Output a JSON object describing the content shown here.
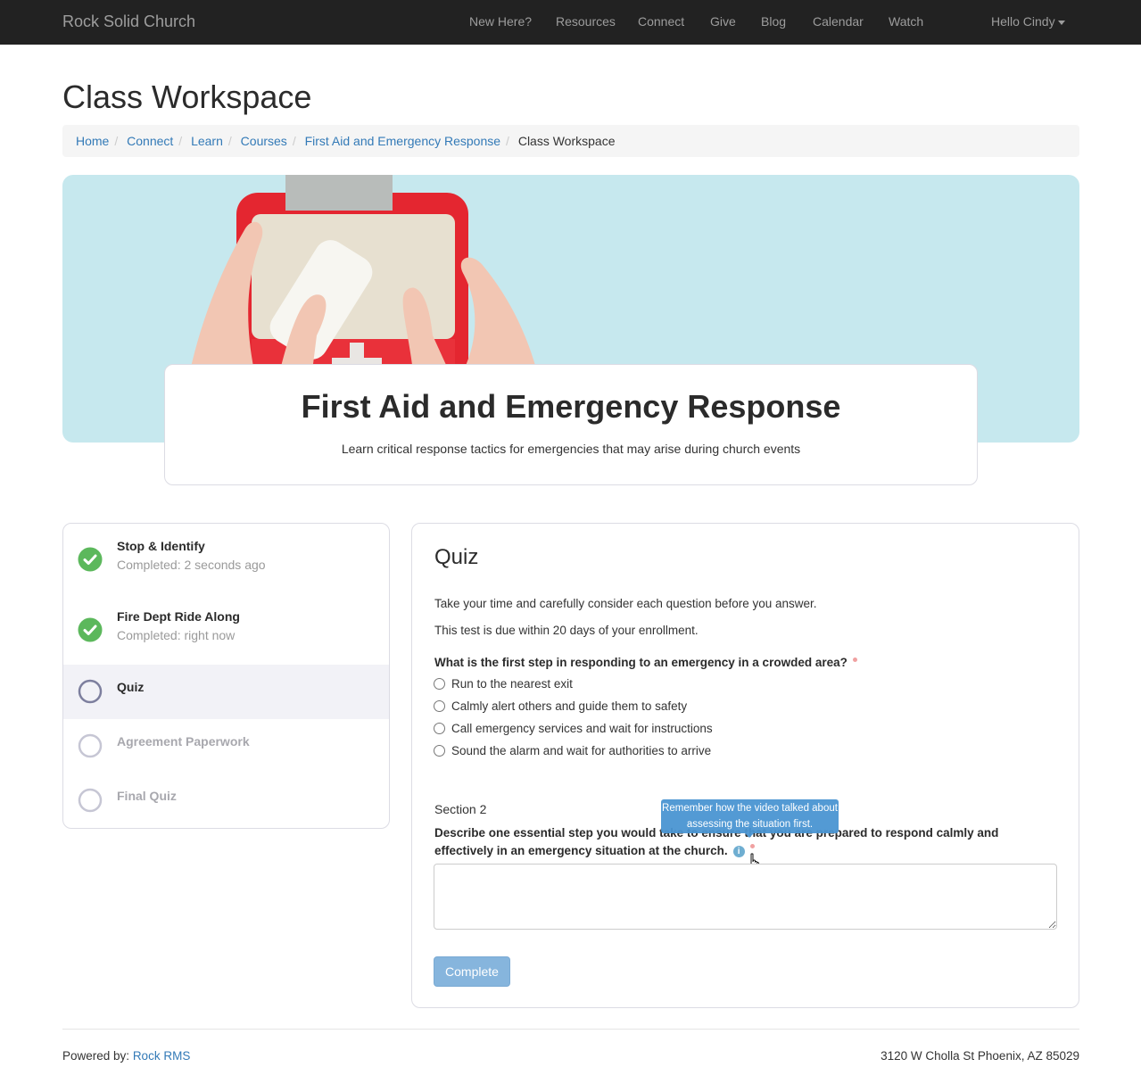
{
  "navbar": {
    "brand": "Rock Solid Church",
    "links": [
      "New Here?",
      "Resources",
      "Connect",
      "Give",
      "Blog",
      "Calendar",
      "Watch"
    ],
    "user_menu": "Hello Cindy"
  },
  "page": {
    "title": "Class Workspace",
    "breadcrumb": [
      "Home",
      "Connect",
      "Learn",
      "Courses",
      "First Aid and Emergency Response"
    ],
    "breadcrumb_current": "Class Workspace"
  },
  "hero": {
    "title": "First Aid and Emergency Response",
    "subtitle": "Learn critical response tactics for emergencies that may arise during church events",
    "background_color": "#c6e8ee"
  },
  "activities": [
    {
      "title": "Stop & Identify",
      "status": "completed",
      "subtitle": "Completed: 2 seconds ago"
    },
    {
      "title": "Fire Dept Ride Along",
      "status": "completed",
      "subtitle": "Completed: right now"
    },
    {
      "title": "Quiz",
      "status": "current",
      "subtitle": ""
    },
    {
      "title": "Agreement Paperwork",
      "status": "locked",
      "subtitle": ""
    },
    {
      "title": "Final Quiz",
      "status": "locked",
      "subtitle": ""
    }
  ],
  "quiz": {
    "title": "Quiz",
    "intro_1": "Take your time and carefully consider each question before you answer.",
    "intro_2": "This test is due within 20 days of your enrollment.",
    "question_1": "What is the first step in responding to an emergency in a crowded area?",
    "options": [
      "Run to the nearest exit",
      "Calmly alert others and guide them to safety",
      "Call emergency services and wait for instructions",
      "Sound the alarm and wait for authorities to arrive"
    ],
    "section_2_label": "Section 2",
    "question_2": "Describe one essential step you would take to ensure that you are prepared to respond calmly and effectively in an emergency situation at the church.",
    "tooltip": "Remember how the video talked about assessing the situation first.",
    "answer_value": "",
    "complete_label": "Complete"
  },
  "footer": {
    "powered_by_label": "Powered by:",
    "powered_by_link": "Rock RMS",
    "address": "3120 W Cholla St Phoenix, AZ 85029"
  },
  "colors": {
    "navbar_bg": "#222222",
    "link": "#337ab7",
    "success": "#5cb85c",
    "primary_disabled": "#86b5dd",
    "tooltip_bg": "#4a95d2"
  }
}
